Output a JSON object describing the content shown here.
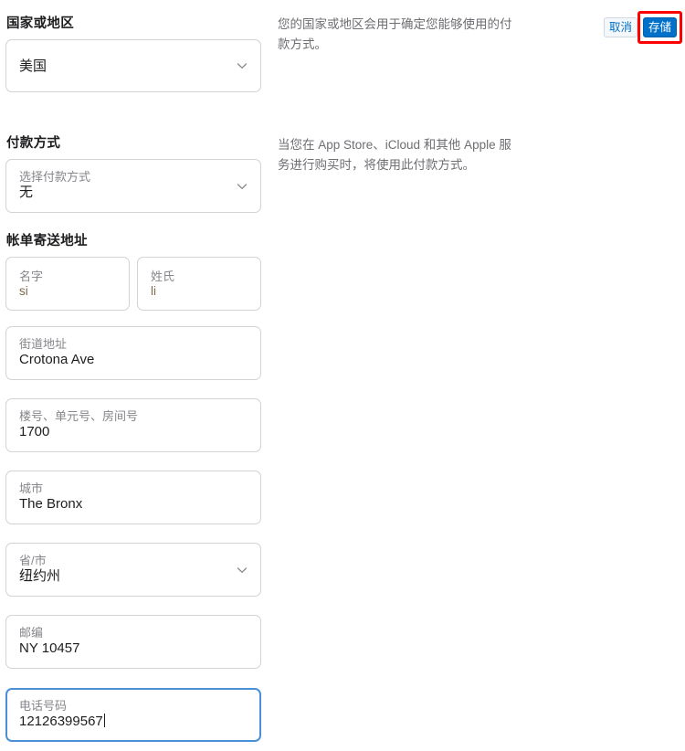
{
  "actions": {
    "cancel_label": "取消",
    "save_label": "存储",
    "highlight_color": "#ff0000",
    "save_bg": "#0070c9",
    "cancel_color": "#0070c9"
  },
  "country_section": {
    "label": "国家或地区",
    "select": {
      "value": "美国",
      "icon": "chevron-down-icon"
    },
    "help_text": "您的国家或地区会用于确定您能够使用的付款方式。"
  },
  "payment_section": {
    "label": "付款方式",
    "select": {
      "placeholder": "选择付款方式",
      "value": "无",
      "icon": "chevron-down-icon"
    },
    "help_text": "当您在 App Store、iCloud 和其他 Apple 服务进行购买时，将使用此付款方式。"
  },
  "billing_section": {
    "label": "帐单寄送地址",
    "fields": {
      "first_name": {
        "placeholder": "名字",
        "value": "si"
      },
      "last_name": {
        "placeholder": "姓氏",
        "value": "li"
      },
      "street": {
        "placeholder": "街道地址",
        "value": "Crotona Ave"
      },
      "apt": {
        "placeholder": "楼号、单元号、房间号",
        "value": "1700"
      },
      "city": {
        "placeholder": "城市",
        "value": "The Bronx"
      },
      "state": {
        "placeholder": "省/市",
        "value": "纽约州",
        "icon": "chevron-down-icon"
      },
      "zip": {
        "placeholder": "邮编",
        "value": "NY 10457"
      },
      "phone": {
        "placeholder": "电话号码",
        "value": "12126399567",
        "focused": true
      }
    }
  }
}
